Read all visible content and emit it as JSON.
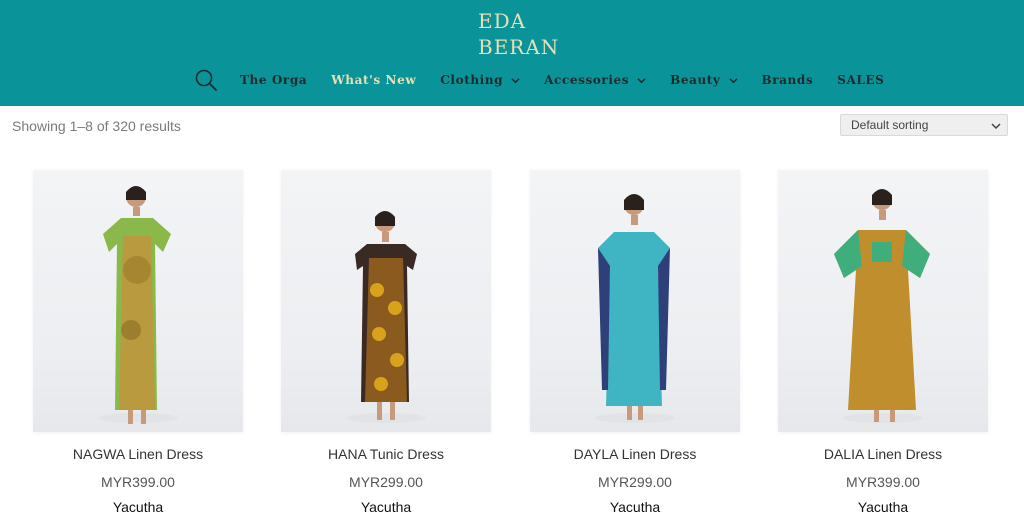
{
  "brand": {
    "logo_line1": "EDA",
    "logo_line2": "BERAN"
  },
  "nav": {
    "search_icon": "search-icon",
    "items": [
      {
        "label": "The Orga",
        "has_dropdown": false
      },
      {
        "label": "What's New",
        "has_dropdown": false,
        "active": true
      },
      {
        "label": "Clothing",
        "has_dropdown": true
      },
      {
        "label": "Accessories",
        "has_dropdown": true
      },
      {
        "label": "Beauty",
        "has_dropdown": true
      },
      {
        "label": "Brands",
        "has_dropdown": false
      },
      {
        "label": "SALES",
        "has_dropdown": false
      }
    ]
  },
  "toolbar": {
    "result_count": "Showing 1–8 of 320 results",
    "sort_selected": "Default sorting"
  },
  "products": [
    {
      "name": "NAGWA Linen Dress",
      "price": "MYR399.00",
      "brand": "Yacutha",
      "dress_color": "#b99a3e",
      "accent_color": "#8ab84a"
    },
    {
      "name": "HANA Tunic Dress",
      "price": "MYR299.00",
      "brand": "Yacutha",
      "dress_color": "#8a5a1e",
      "accent_color": "#d8a21c"
    },
    {
      "name": "DAYLA Linen Dress",
      "price": "MYR299.00",
      "brand": "Yacutha",
      "dress_color": "#3fb5c4",
      "accent_color": "#2e3f7a"
    },
    {
      "name": "DALIA Linen Dress",
      "price": "MYR399.00",
      "brand": "Yacutha",
      "dress_color": "#c08e2c",
      "accent_color": "#3fae7c"
    }
  ],
  "colors": {
    "header_bg": "#0a9499",
    "logo": "#e9dfb7",
    "nav_text": "#1f2a2b",
    "nav_active": "#e9dfb7"
  }
}
